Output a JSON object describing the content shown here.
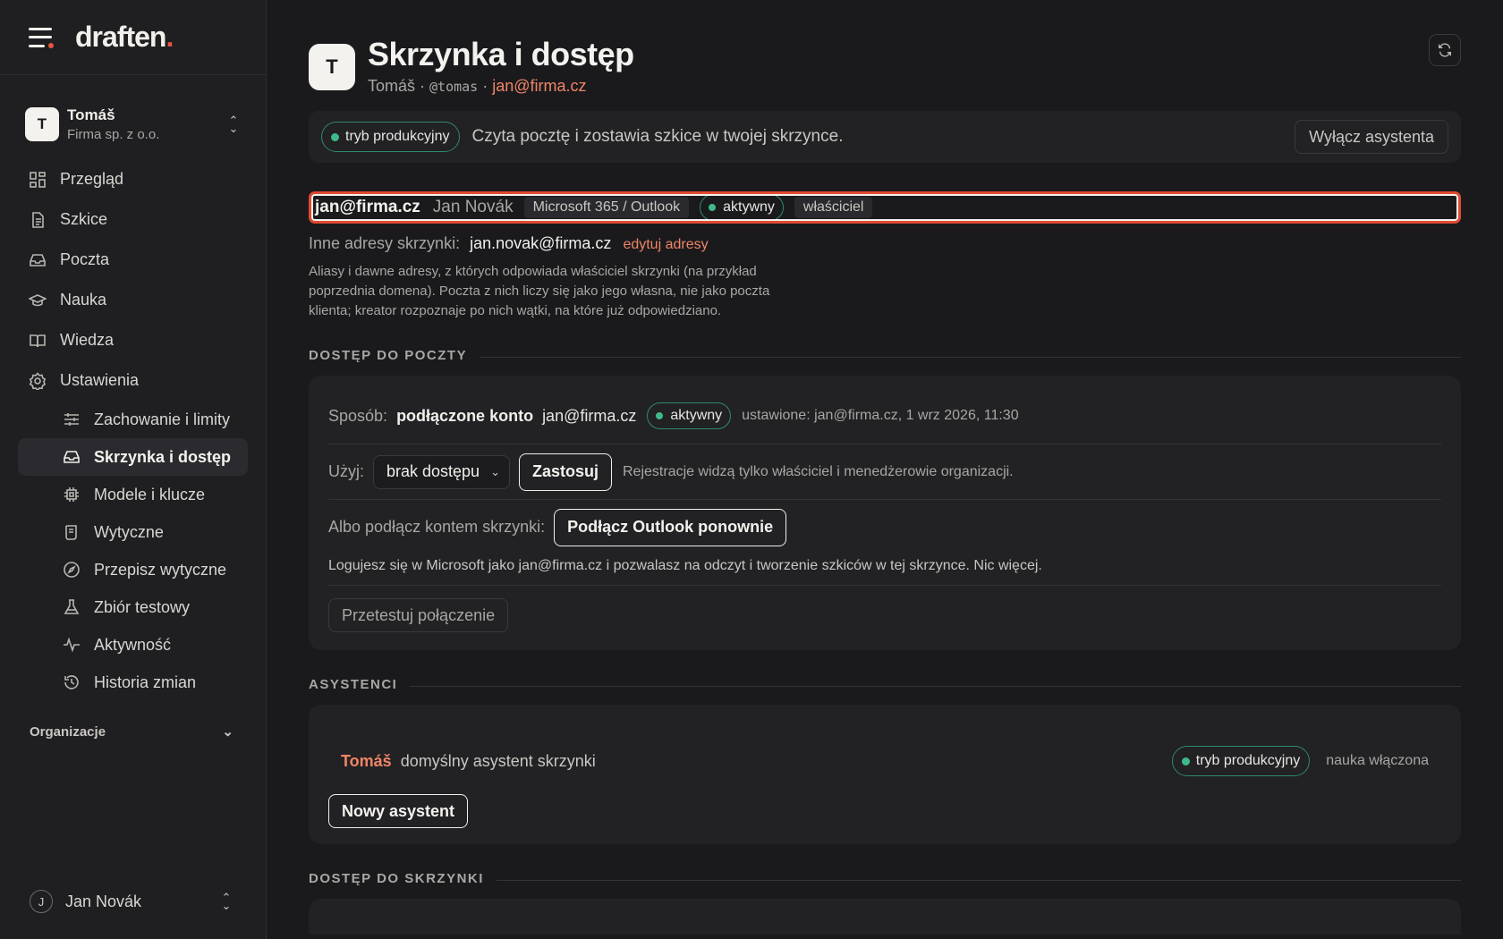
{
  "brand": {
    "logo_text": "draften",
    "logo_dot": "."
  },
  "org_switcher": {
    "initial": "T",
    "name": "Tomáš",
    "company": "Firma sp. z o.o."
  },
  "nav": [
    {
      "label": "Przegląd",
      "icon": "dashboard-icon"
    },
    {
      "label": "Szkice",
      "icon": "document-icon"
    },
    {
      "label": "Poczta",
      "icon": "inbox-icon"
    },
    {
      "label": "Nauka",
      "icon": "graduation-cap-icon"
    },
    {
      "label": "Wiedza",
      "icon": "book-icon"
    },
    {
      "label": "Ustawienia",
      "icon": "gear-icon"
    }
  ],
  "settings_sub": [
    {
      "label": "Zachowanie i limity",
      "icon": "sliders-icon"
    },
    {
      "label": "Skrzynka i dostęp",
      "icon": "inbox-icon",
      "active": true
    },
    {
      "label": "Modele i klucze",
      "icon": "chip-icon"
    },
    {
      "label": "Wytyczne",
      "icon": "scroll-icon"
    },
    {
      "label": "Przepisz wytyczne",
      "icon": "compass-icon"
    },
    {
      "label": "Zbiór testowy",
      "icon": "flask-icon"
    },
    {
      "label": "Aktywność",
      "icon": "activity-icon"
    },
    {
      "label": "Historia zmian",
      "icon": "history-icon"
    }
  ],
  "organizations_label": "Organizacje",
  "user": {
    "initial": "J",
    "name": "Jan Novák"
  },
  "header": {
    "initial": "T",
    "title": "Skrzynka i dostęp",
    "name": "Tomáš",
    "sep1": " · ",
    "handle": "@tomas",
    "sep2": " · ",
    "email": "jan@firma.cz"
  },
  "banner": {
    "mode": "tryb produkcyjny",
    "text": "Czyta pocztę i zostawia szkice w twojej skrzynce.",
    "disable_button": "Wyłącz asystenta"
  },
  "account": {
    "email": "jan@firma.cz",
    "name": "Jan Novák",
    "provider": "Microsoft 365 / Outlook",
    "status": "aktywny",
    "role": "właściciel"
  },
  "aliases": {
    "label": "Inne adresy skrzynki:",
    "value": "jan.novak@firma.cz",
    "edit_link": "edytuj adresy",
    "note": "Aliasy i dawne adresy, z których odpowiada właściciel skrzynki (na przykład poprzednia domena). Poczta z nich liczy się jako jego własna, nie jako poczta klienta; kreator rozpoznaje po nich wątki, na które już odpowiedziano."
  },
  "mail_access": {
    "section_title": "DOSTĘP DO POCZTY",
    "method_label": "Sposób:",
    "method_value": "podłączone konto",
    "method_account": "jan@firma.cz",
    "status": "aktywny",
    "set_info": "ustawione: jan@firma.cz, 1 wrz 2026, 11:30",
    "use_label": "Użyj:",
    "use_selected": "brak dostępu",
    "apply_button": "Zastosuj",
    "use_note": "Rejestracje widzą tylko właściciel i menedżerowie organizacji.",
    "connect_label": "Albo podłącz kontem skrzynki:",
    "connect_button": "Podłącz Outlook ponownie",
    "connect_desc": "Logujesz się w Microsoft jako jan@firma.cz i pozwalasz na odczyt i tworzenie szkiców w tej skrzynce. Nic więcej.",
    "test_button": "Przetestuj połączenie"
  },
  "assistants": {
    "section_title": "ASYSTENCI",
    "name": "Tomáš",
    "description": "domyślny asystent skrzynki",
    "mode": "tryb produkcyjny",
    "learning": "nauka włączona",
    "new_button": "Nowy asystent"
  },
  "mailbox_access": {
    "section_title": "DOSTĘP DO SKRZYNKI"
  },
  "colors": {
    "accent": "#ef8566",
    "brand_dot": "#e5553e",
    "active_green": "#3fb98a",
    "highlight": "#e04a32"
  }
}
